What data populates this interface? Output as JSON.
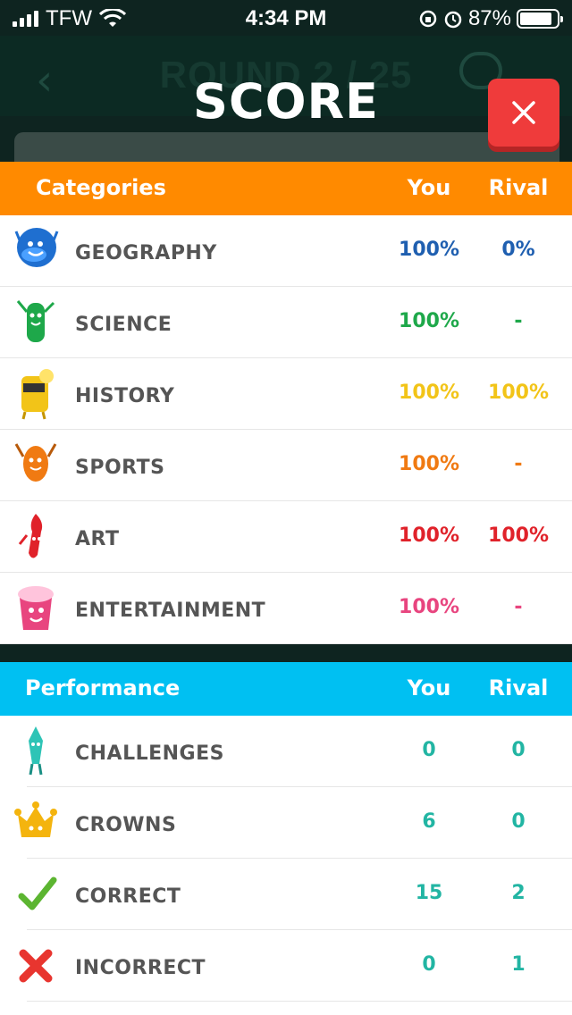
{
  "status_bar": {
    "carrier": "TFW",
    "time": "4:34 PM",
    "battery": "87%",
    "battery_level": 0.87
  },
  "background": {
    "round_text": "ROUND 2 / 25",
    "back_icon": "chevron-left-icon",
    "chat_icon": "chat-bubbles-icon"
  },
  "modal": {
    "title": "SCORE",
    "close_icon": "close-icon",
    "close_color": "#ef3b3b"
  },
  "categories": {
    "header": {
      "title": "Categories",
      "you": "You",
      "rival": "Rival",
      "color": "#ff8a00"
    },
    "items": [
      {
        "label": "GEOGRAPHY",
        "you": "100%",
        "rival": "0%",
        "color": "#1f5fb0",
        "icon": "geography-character-icon"
      },
      {
        "label": "SCIENCE",
        "you": "100%",
        "rival": "-",
        "color": "#1ea84a",
        "icon": "science-character-icon"
      },
      {
        "label": "HISTORY",
        "you": "100%",
        "rival": "100%",
        "color": "#f2c418",
        "icon": "history-character-icon"
      },
      {
        "label": "SPORTS",
        "you": "100%",
        "rival": "-",
        "color": "#f07a12",
        "icon": "sports-character-icon"
      },
      {
        "label": "ART",
        "you": "100%",
        "rival": "100%",
        "color": "#e0222a",
        "icon": "art-character-icon"
      },
      {
        "label": "ENTERTAINMENT",
        "you": "100%",
        "rival": "-",
        "color": "#e8457f",
        "icon": "entertainment-character-icon"
      }
    ]
  },
  "performance": {
    "header": {
      "title": "Performance",
      "you": "You",
      "rival": "Rival",
      "color": "#00c0f2"
    },
    "items": [
      {
        "label": "CHALLENGES",
        "you": "0",
        "rival": "0",
        "icon": "challenges-character-icon"
      },
      {
        "label": "CROWNS",
        "you": "6",
        "rival": "0",
        "icon": "crown-character-icon"
      },
      {
        "label": "CORRECT",
        "you": "15",
        "rival": "2",
        "icon": "checkmark-icon"
      },
      {
        "label": "INCORRECT",
        "you": "0",
        "rival": "1",
        "icon": "cross-icon"
      }
    ]
  }
}
